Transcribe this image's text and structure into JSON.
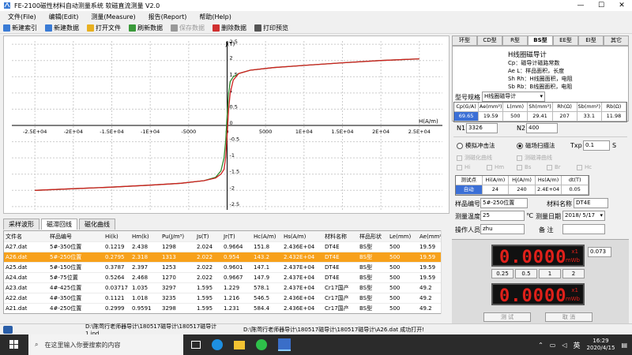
{
  "window": {
    "title": "FE-2100磁性材料自动测量系统 软磁直流测量 V2.0",
    "min": "—",
    "max": "☐",
    "close": "✕"
  },
  "menu": [
    "文件(File)",
    "编辑(Edit)",
    "测量(Measure)",
    "报告(Report)",
    "帮助(Help)"
  ],
  "toolbar": [
    {
      "label": "新建索引",
      "icon": "new-index-icon",
      "color": "#3a7bd5",
      "enabled": true
    },
    {
      "label": "新建数据",
      "icon": "new-data-icon",
      "color": "#3a7bd5",
      "enabled": true
    },
    {
      "label": "打开文件",
      "icon": "open-folder-icon",
      "color": "#e8b020",
      "enabled": true
    },
    {
      "label": "刷新数据",
      "icon": "refresh-icon",
      "color": "#3a9a3a",
      "enabled": true
    },
    {
      "label": "保存数据",
      "icon": "save-icon",
      "color": "#999999",
      "enabled": false
    },
    {
      "label": "删除数据",
      "icon": "delete-icon",
      "color": "#d03030",
      "enabled": true
    },
    {
      "label": "打印预览",
      "icon": "print-preview-icon",
      "color": "#555555",
      "enabled": true
    }
  ],
  "chart_data": {
    "type": "line",
    "xlabel": "H(A/m)",
    "ylabel": "J(T)",
    "xlim": [
      -28000,
      28000
    ],
    "ylim": [
      -2.6,
      2.6
    ],
    "x_ticks": [
      "-2.5E+04",
      "-2E+04",
      "-1.5E+04",
      "-1E+04",
      "-5000",
      "0",
      "5000",
      "1E+04",
      "1.5E+04",
      "2E+04",
      "2.5E+04"
    ],
    "x_tick_values": [
      -25000,
      -20000,
      -15000,
      -10000,
      -5000,
      0,
      5000,
      10000,
      15000,
      20000,
      25000
    ],
    "y_ticks": [
      "-2.5",
      "-2",
      "-1.5",
      "-1",
      "-0.5",
      "0",
      "0.5",
      "1",
      "1.5",
      "2",
      "2.5"
    ],
    "y_tick_values": [
      -2.5,
      -2,
      -1.5,
      -1,
      -0.5,
      0,
      0.5,
      1,
      1.5,
      2,
      2.5
    ],
    "series": [
      {
        "color": "#2e8b2e",
        "x": [
          -25000,
          -20000,
          -15000,
          -10000,
          -6000,
          -3000,
          -1500,
          -800,
          -400,
          -200,
          0,
          200,
          400,
          800,
          1500,
          3000,
          6000,
          10000,
          15000,
          20000,
          25000
        ],
        "y": [
          -2.0,
          -1.95,
          -1.9,
          -1.84,
          -1.78,
          -1.7,
          -1.6,
          -1.4,
          -1.0,
          -0.5,
          0.3,
          1.0,
          1.35,
          1.5,
          1.6,
          1.7,
          1.78,
          1.85,
          1.93,
          2.0,
          2.05
        ]
      },
      {
        "color": "#d02020",
        "x": [
          -25000,
          -20000,
          -15000,
          -10000,
          -6000,
          -3000,
          -1500,
          -800,
          -400,
          -200,
          0,
          200,
          400,
          800,
          1500,
          3000,
          6000,
          10000,
          15000,
          20000,
          25000
        ],
        "y": [
          -2.0,
          -1.95,
          -1.9,
          -1.84,
          -1.78,
          -1.7,
          -1.62,
          -1.5,
          -1.35,
          -1.0,
          -0.3,
          0.5,
          1.0,
          1.4,
          1.6,
          1.7,
          1.78,
          1.85,
          1.93,
          2.0,
          2.05
        ]
      }
    ]
  },
  "bottom_tabs": [
    {
      "label": "采样波形",
      "active": false
    },
    {
      "label": "磁滞回线",
      "active": true
    },
    {
      "label": "磁化曲线",
      "active": false
    }
  ],
  "table": {
    "headers": [
      "文件名",
      "样品编号",
      "Hi(k)",
      "Hm(k)",
      "Pu(J/m³)",
      "Js(T)",
      "Jr(T)",
      "Hc(A/m)",
      "Hs(A/m)",
      "材料名称",
      "样品形状",
      "Le(mm)",
      "Ae(mm²)"
    ],
    "rows": [
      [
        "A27.dat",
        "5#-350位置",
        "0.1219",
        "2.438",
        "1298",
        "2.024",
        "0.9664",
        "151.8",
        "2.436E+04",
        "DT4E",
        "BS型",
        "500",
        "19.59"
      ],
      [
        "A26.dat",
        "5#-250位置",
        "0.2795",
        "2.318",
        "1313",
        "2.022",
        "0.954",
        "143.2",
        "2.432E+04",
        "DT4E",
        "BS型",
        "500",
        "19.59"
      ],
      [
        "A25.dat",
        "5#-150位置",
        "0.3787",
        "2.397",
        "1253",
        "2.022",
        "0.9601",
        "147.1",
        "2.437E+04",
        "DT4E",
        "BS型",
        "500",
        "19.59"
      ],
      [
        "A24.dat",
        "5#-75位置",
        "0.5264",
        "2.468",
        "1270",
        "2.022",
        "0.9667",
        "147.9",
        "2.437E+04",
        "DT4E",
        "BS型",
        "500",
        "19.59"
      ],
      [
        "A23.dat",
        "4#-425位置",
        "0.03717",
        "1.035",
        "3297",
        "1.595",
        "1.229",
        "578.1",
        "2.437E+04",
        "Cr17国产",
        "BS型",
        "500",
        "49.2"
      ],
      [
        "A22.dat",
        "4#-350位置",
        "0.1121",
        "1.018",
        "3235",
        "1.595",
        "1.216",
        "546.5",
        "2.436E+04",
        "Cr17国产",
        "BS型",
        "500",
        "49.2"
      ],
      [
        "A21.dat",
        "4#-250位置",
        "0.2999",
        "0.9591",
        "3298",
        "1.595",
        "1.231",
        "584.4",
        "2.436E+04",
        "Cr17国产",
        "BS型",
        "500",
        "49.2"
      ]
    ],
    "selected_row": 1
  },
  "status": {
    "path": "D:\\陈莺行老师器导计\\180517磁导计\\180517磁导计1.ind",
    "message": "D:\\陈莺行老师器导计\\180517磁导计\\180517磁导计\\A26.dat 成功打开!"
  },
  "right": {
    "tabs": [
      "环型",
      "CD型",
      "R型",
      "BS型",
      "EE型",
      "EI型",
      "其它"
    ],
    "active_tab": "BS型",
    "desc_title": "H线圈磁导计",
    "desc_lines": [
      "Cp：磁导计磁路常数",
      "Ae L：样品面积，长度",
      "Sh Rh：H线圈面积，电阻",
      "Sb Rb：B线圈面积，电阻"
    ],
    "spec_label": "型号规格",
    "spec_value": "H线圈磁导计",
    "param_headers": [
      "Cp(G/A)",
      "Ae(mm²)",
      "L(mm)",
      "Sh(mm²)",
      "Rh(Ω)",
      "Sb(mm²)",
      "Rb(Ω)"
    ],
    "param_values": [
      "69.65",
      "19.59",
      "500",
      "29.41",
      "207",
      "33.1",
      "11.98"
    ],
    "n1_label": "N1",
    "n1_value": "3326",
    "n2_label": "N2",
    "n2_value": "400",
    "method1": "模拟冲击法",
    "method2": "磁场扫描法",
    "method_selected": 2,
    "txp_label": "Txp",
    "txp_value": "0.1",
    "txp_unit": "S",
    "chk_row1": [
      "测磁化曲线",
      "测磁滞曲线"
    ],
    "chk_row2": [
      "Hi",
      "Hm",
      "Bs",
      "Br",
      "Hc"
    ],
    "test_headers": [
      "测试点",
      "Hi(A/m)",
      "Hj(A/m)",
      "Hs(A/m)",
      "dt(T)"
    ],
    "test_values": [
      "自动",
      "24",
      "240",
      "2.4E+04",
      "0.05"
    ],
    "sample_no_label": "样品编号",
    "sample_no": "5#-250位置",
    "material_label": "材料名称",
    "material": "DT4E",
    "temp_label": "测量温度",
    "temp": "25",
    "temp_unit": "℃",
    "date_label": "测量日期",
    "date": "2018/ 5/17",
    "operator_label": "操作人员",
    "operator": "zhu",
    "remark_label": "备    注",
    "remark": "",
    "meter1": {
      "digits": "0.0000",
      "mult": "x1",
      "unit": "mWb",
      "side_value": "0.073"
    },
    "range_buttons": [
      "0.25",
      "0.5",
      "1",
      "2"
    ],
    "meter2": {
      "digits": "0.0000",
      "mult": "x1",
      "unit": "mWb"
    },
    "test_button": "测  试",
    "cancel_button": "取  消"
  },
  "taskbar": {
    "search_placeholder": "在这里输入你要搜索的内容",
    "lang": "英",
    "time": "16:29",
    "date": "2020/4/15"
  }
}
